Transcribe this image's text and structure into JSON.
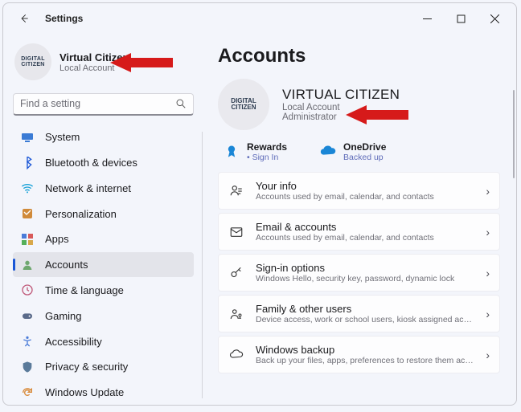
{
  "window": {
    "title": "Settings"
  },
  "user": {
    "name": "Virtual Citizen",
    "sub": "Local Account",
    "avatar_text": "DIGITAL\nCITIZEN"
  },
  "search": {
    "placeholder": "Find a setting"
  },
  "nav": [
    {
      "key": "system",
      "label": "System"
    },
    {
      "key": "bluetooth",
      "label": "Bluetooth & devices"
    },
    {
      "key": "network",
      "label": "Network & internet"
    },
    {
      "key": "personalization",
      "label": "Personalization"
    },
    {
      "key": "apps",
      "label": "Apps"
    },
    {
      "key": "accounts",
      "label": "Accounts",
      "active": true
    },
    {
      "key": "time",
      "label": "Time & language"
    },
    {
      "key": "gaming",
      "label": "Gaming"
    },
    {
      "key": "accessibility",
      "label": "Accessibility"
    },
    {
      "key": "privacy",
      "label": "Privacy & security"
    },
    {
      "key": "update",
      "label": "Windows Update"
    }
  ],
  "page": {
    "title": "Accounts",
    "hero": {
      "name": "VIRTUAL CITIZEN",
      "sub1": "Local Account",
      "sub2": "Administrator",
      "avatar_text": "DIGITAL\nCITIZEN"
    },
    "tiles": [
      {
        "key": "rewards",
        "title": "Rewards",
        "sub": "• Sign In"
      },
      {
        "key": "onedrive",
        "title": "OneDrive",
        "sub": "Backed up"
      }
    ],
    "cards": [
      {
        "key": "yourinfo",
        "title": "Your info",
        "sub": "Accounts used by email, calendar, and contacts"
      },
      {
        "key": "email",
        "title": "Email & accounts",
        "sub": "Accounts used by email, calendar, and contacts"
      },
      {
        "key": "signin",
        "title": "Sign-in options",
        "sub": "Windows Hello, security key, password, dynamic lock"
      },
      {
        "key": "family",
        "title": "Family & other users",
        "sub": "Device access, work or school users, kiosk assigned access"
      },
      {
        "key": "backup",
        "title": "Windows backup",
        "sub": "Back up your files, apps, preferences to restore them across"
      }
    ]
  }
}
